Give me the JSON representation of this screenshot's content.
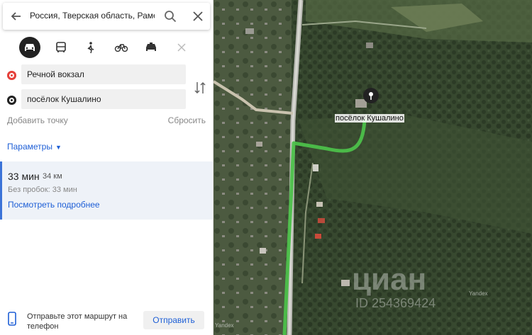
{
  "search": {
    "query": "Россия, Тверская область, Рамешк"
  },
  "modes": [
    {
      "name": "car-icon",
      "active": true
    },
    {
      "name": "bus-icon",
      "active": false
    },
    {
      "name": "walk-icon",
      "active": false
    },
    {
      "name": "bike-icon",
      "active": false
    },
    {
      "name": "taxi-icon",
      "active": false
    },
    {
      "name": "scooter-icon",
      "active": false
    }
  ],
  "route": {
    "from": "Речной вокзал",
    "to": "посёлок Кушалино",
    "add_point": "Добавить точку",
    "reset": "Сбросить",
    "params": "Параметры"
  },
  "result": {
    "time": "33 мин",
    "distance": "34 км",
    "no_jams": "Без пробок: 33 мин",
    "details": "Посмотреть подробнее"
  },
  "send": {
    "text": "Отправьте этот маршрут на телефон",
    "button": "Отправить"
  },
  "map": {
    "place_label": "посёлок Кушалино",
    "watermark": "циан",
    "watermark_id": "ID 254369424",
    "attribution": "Yandex"
  },
  "colors": {
    "route": "#4cc04a",
    "link": "#1e5fd6",
    "from_marker": "#e5403a",
    "to_marker": "#222222"
  }
}
